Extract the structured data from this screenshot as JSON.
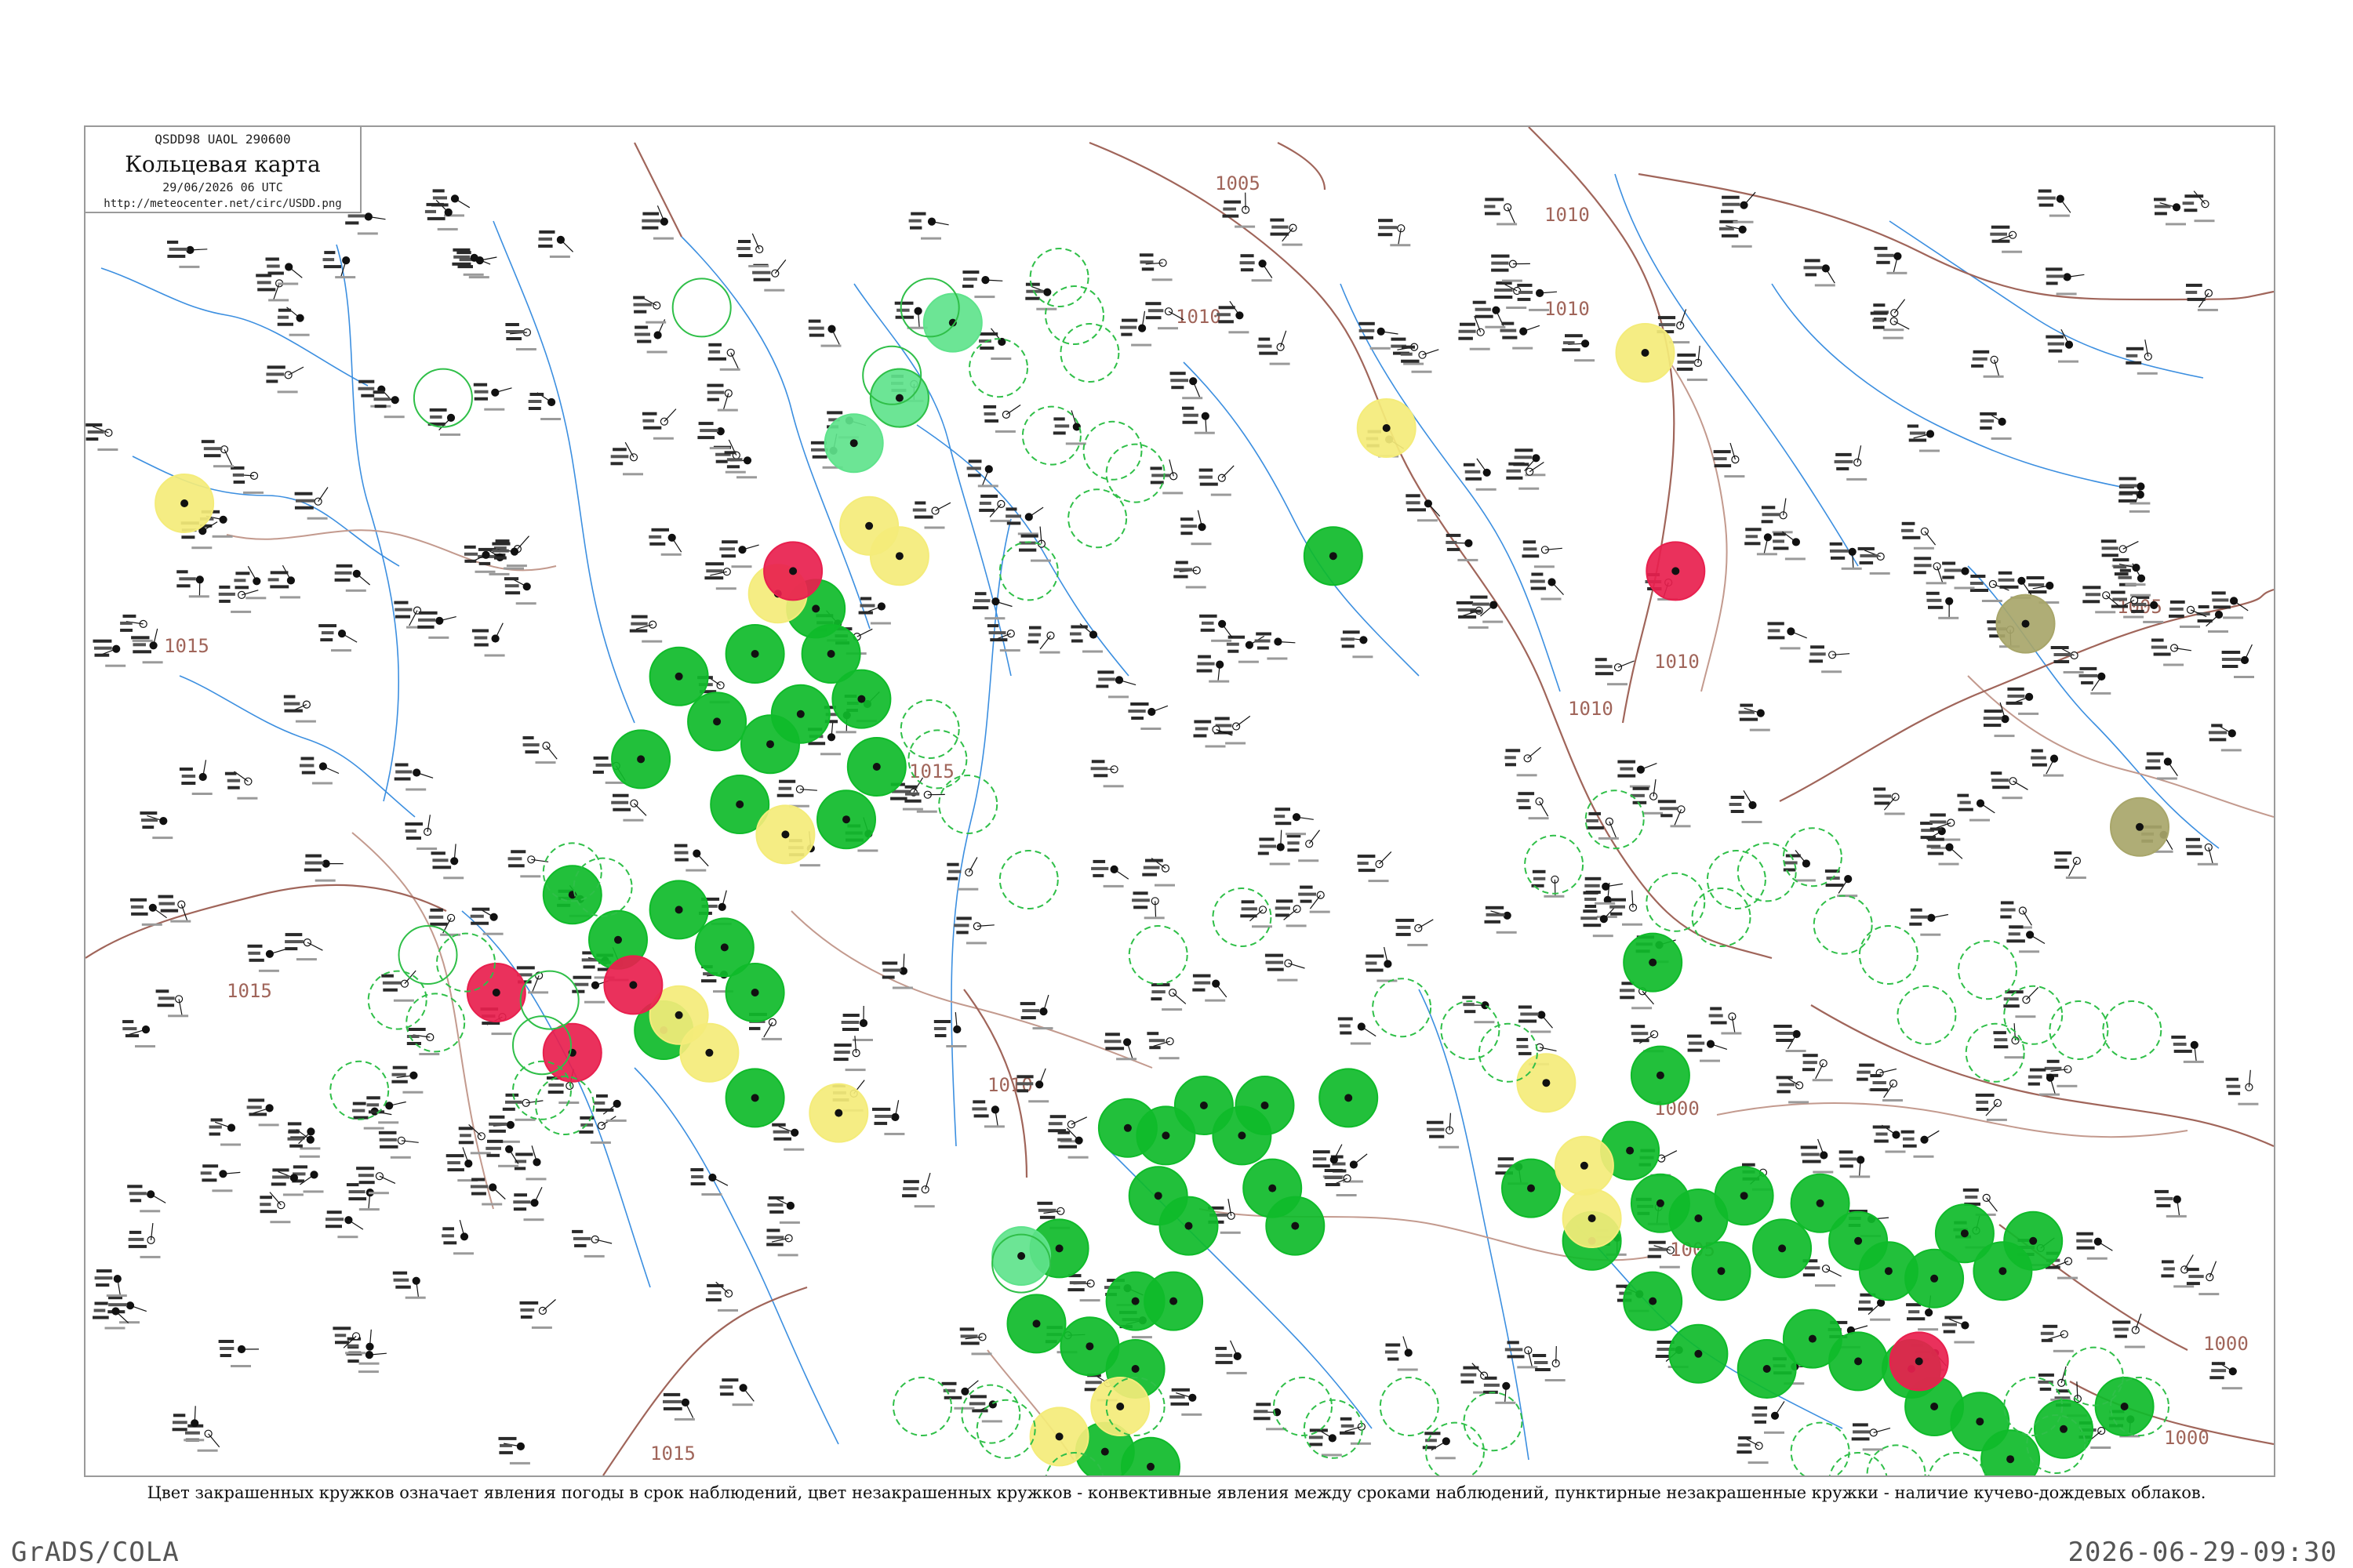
{
  "header": {
    "code": "QSDD98  UAOL  290600",
    "title": "Кольцевая карта",
    "date": "29/06/2026 06 UTC",
    "url": "http://meteocenter.net/circ/USDD.png"
  },
  "isobars": {
    "labels": [
      "1005",
      "1010",
      "1010",
      "1010",
      "1010",
      "1010",
      "1005",
      "1005",
      "1000",
      "1000",
      "1000",
      "1015",
      "1015",
      "1015",
      "1010",
      "1015"
    ]
  },
  "colors": {
    "isobar": "#a0655a",
    "river": "#3c8fe0",
    "border": "#c39a8e",
    "circle_green": "#0fbb2a",
    "circle_yellow": "#f4ec7a",
    "circle_red": "#e8204e",
    "circle_lightgreen": "#5fe38c",
    "circle_olive": "#a8a66a",
    "station": "#111111"
  },
  "legend": {
    "caption": "Цвет закрашенных кружков означает явления погоды в срок наблюдений, цвет незакрашенных кружков - конвективные явления между сроками наблюдений, пунктирные незакрашенные кружки - наличие кучево-дождевых облаков."
  },
  "footer": {
    "left": "GrADS/COLA",
    "right": "2026-06-29-09:30"
  }
}
